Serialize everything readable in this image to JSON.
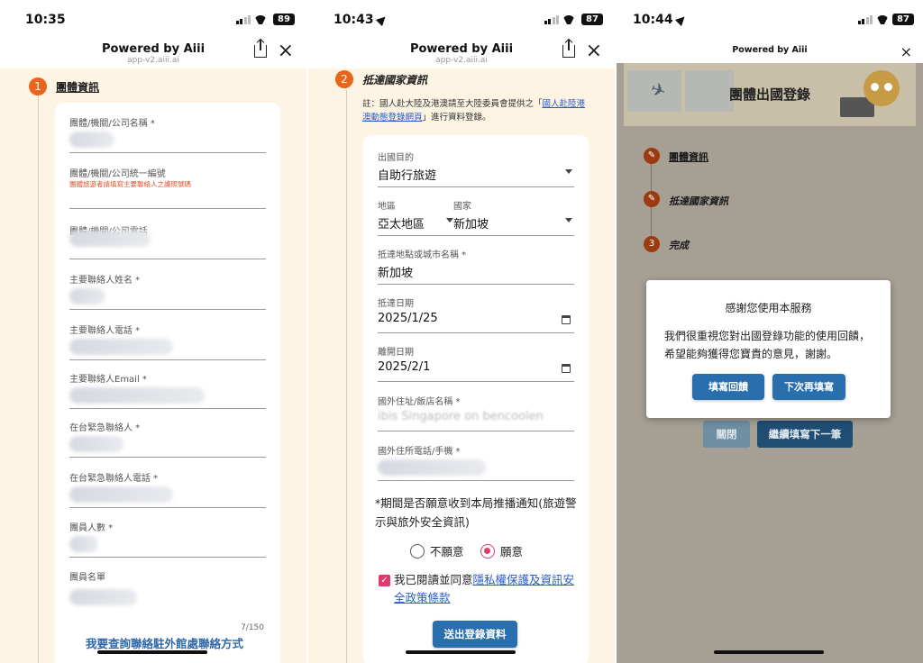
{
  "common": {
    "powered_by": "Powered by Aiii",
    "url": "app-v2.aiii.ai"
  },
  "screen1": {
    "time": "10:35",
    "battery": "89",
    "step_num": "1",
    "step_label": "團體資訊",
    "fields": [
      {
        "label": "團體/機關/公司名稱 *"
      },
      {
        "label": "團體/機關/公司統一編號",
        "error": "團體旅遊者請填寫主要聯絡人之護照號碼"
      },
      {
        "label": "團體/機關/公司電話"
      },
      {
        "label": "主要聯絡人姓名 *"
      },
      {
        "label": "主要聯絡人電話 *"
      },
      {
        "label": "主要聯絡人Email *"
      },
      {
        "label": "在台緊急聯絡人 *"
      },
      {
        "label": "在台緊急聯絡人電話 *"
      },
      {
        "label": "團員人數 *"
      },
      {
        "label": "團員名單"
      }
    ],
    "counter": "7/150",
    "contact_link": "我要查詢聯絡駐外館處聯絡方式"
  },
  "screen2": {
    "time": "10:43",
    "battery": "87",
    "step_num": "2",
    "step_label": "抵達國家資訊",
    "note_prefix": "註：國人赴大陸及港澳請至大陸委員會提供之「",
    "note_link": "國人赴陸港澳動態登錄網頁",
    "note_suffix": "」進行資料登錄。",
    "purpose_label": "出國目的",
    "purpose_value": "自助行旅遊",
    "region_label": "地區",
    "region_value": "亞太地區",
    "country_label": "國家",
    "country_value": "新加坡",
    "city_label": "抵達地點或城市名稱 *",
    "city_value": "新加坡",
    "arrive_label": "抵達日期",
    "arrive_value": "2025/1/25",
    "leave_label": "離開日期",
    "leave_value": "2025/2/1",
    "hotel_label": "國外住址/飯店名稱 *",
    "hotel_value": "ibis Singapore on bencoolen",
    "phone_label": "國外住所電話/手機 *",
    "question": "*期間是否願意收到本局推播通知(旅遊警示與旅外安全資訊)",
    "opt_no": "不願意",
    "opt_yes": "願意",
    "selected": "願意",
    "agree_prefix": "我已閱讀並同意",
    "agree_link": "隱私權保護及資訊安全政策條款",
    "agree_checked": true,
    "submit": "送出登錄資料"
  },
  "screen3": {
    "time": "10:44",
    "battery": "87",
    "banner_title": "團體出國登錄",
    "steps": [
      {
        "num": "✎",
        "label": "團體資訊"
      },
      {
        "num": "✎",
        "label": "抵達國家資訊"
      },
      {
        "num": "3",
        "label": "完成"
      }
    ],
    "bg_close": "關閉",
    "bg_continue": "繼續填寫下一筆",
    "modal_title": "感謝您使用本服務",
    "modal_body": "我們很重視您對出國登錄功能的使用回饋，希望能夠獲得您寶貴的意見，謝謝。",
    "modal_fill": "填寫回饋",
    "modal_later": "下次再填寫"
  },
  "colors": {
    "accent_orange": "#e8651c",
    "primary_blue": "#2a6fad",
    "cream_bg": "#fdf4e3",
    "radio_pink": "#e0396c",
    "link_blue": "#2a5ac8"
  }
}
